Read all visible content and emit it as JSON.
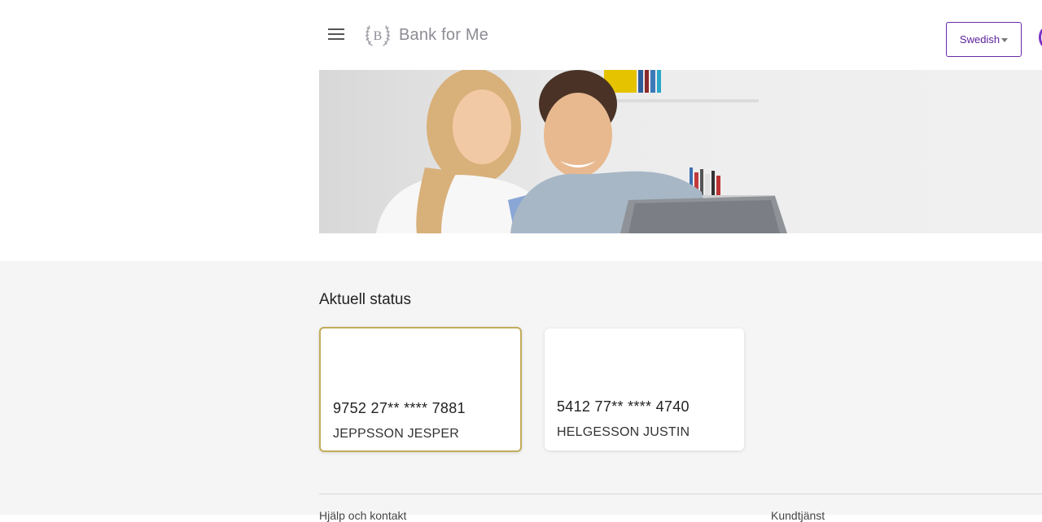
{
  "header": {
    "brand": "Bank for Me",
    "logo_letter": "B",
    "language": "Swedish"
  },
  "main": {
    "section_title": "Aktuell status",
    "cards": [
      {
        "number": "9752 27** **** 7881",
        "holder": "JEPPSSON JESPER",
        "selected": true
      },
      {
        "number": "5412 77** **** 4740",
        "holder": "HELGESSON JUSTIN",
        "selected": false
      }
    ]
  },
  "footer": {
    "left_text": "Hjälp och kontakt",
    "right_text": "Kundtjänst"
  },
  "colors": {
    "accent_purple": "#6a2aa8",
    "selected_card_border": "#c2ac5a",
    "content_background": "#f5f5f5"
  },
  "icons": [
    "menu-icon",
    "laurel-logo-icon",
    "chevron-down-icon",
    "avatar-icon"
  ]
}
